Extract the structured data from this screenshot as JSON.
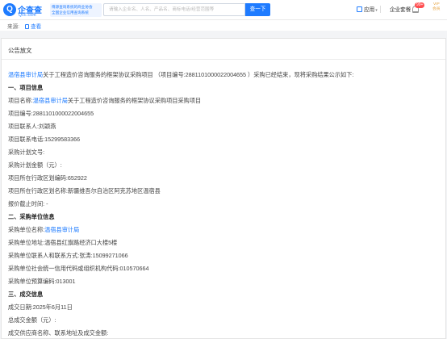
{
  "header": {
    "logo_text": "企查查",
    "logo_sub": "Qcc.com",
    "slogan_line1": "傅源查询系统的商业协会",
    "slogan_line2": "全国企业信用查询系统",
    "search_placeholder": "请输入企业名、人名、产品名、商标电话/经营范围等",
    "search_button": "查一下",
    "nav_app": "应用",
    "nav_suite": "企业套餐",
    "badge": "99+",
    "vip_label_line1": "VIP",
    "vip_label_line2": "会员"
  },
  "source": {
    "label": "来源:",
    "link": "查看"
  },
  "announcement": {
    "title": "公告放文",
    "intro_prefix": "温宿县审计局",
    "intro_rest": "关于工程造价咨询服务的框架协议采购项目 （项目编号:2881101000022004655 ）采购已经结束，现将采购结果公示如下:",
    "section1": "一、项目信息",
    "project_name_label": "项目名称:",
    "project_name_link": "温宿县审计局",
    "project_name_rest": "关于工程造价咨询服务的框架协议采购项目采购项目",
    "project_no": "项目编号:2881101000022004655",
    "contact": "项目联系人:刘颖燕",
    "phone": "项目联系电话:15299583366",
    "plan_doc": "采购计划文号:",
    "plan_amount": "采购计划金额（元）:",
    "region_code": "项目所在行政区划编码:652922",
    "region_name": "项目所在行政区划名称:新疆维吾尔自治区阿克苏地区温宿县",
    "deadline": "报价截止时间: -",
    "section2": "二、采购单位信息",
    "buyer_label": "采购单位名称:",
    "buyer_link": "温宿县审计局",
    "buyer_address": "采购单位地址:温宿县红旗路经济口大楼5楼",
    "buyer_contact": "采购单位联系人和联系方式:张涛:15099271066",
    "buyer_credit_code": "采购单位社会统一信用代码或组织机构代码:010570664",
    "buyer_budget_code": "采购单位预算编码:013001",
    "section3": "三、成交信息",
    "deal_date": "成交日期:2025年6月11日",
    "deal_amount": "总成交金额（元）:",
    "deal_supplier": "成交供应商名称、联系地址及成交金额:"
  }
}
